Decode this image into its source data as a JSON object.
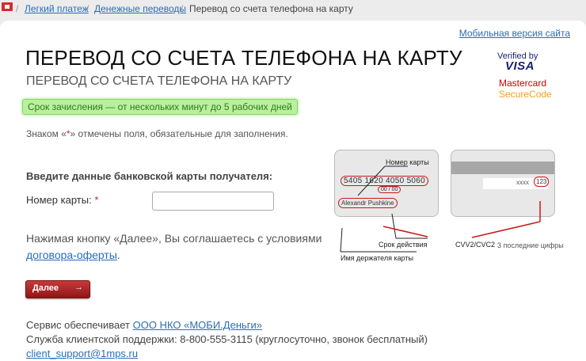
{
  "breadcrumbs": {
    "items": [
      "Легкий платеж",
      "Денежные переводы"
    ],
    "current": "Перевод со счета телефона на карту"
  },
  "header": {
    "mobile_link": "Мобильная версия сайта",
    "title": "ПЕРЕВОД СО СЧЕТА ТЕЛЕФОНА НА КАРТУ",
    "subtitle": "ПЕРЕВОД СО СЧЕТА ТЕЛЕФОНА НА КАРТУ"
  },
  "logos": {
    "visa_by": "Verified by",
    "visa": "VISA",
    "mastercard": "Mastercard",
    "securecode": "SecureCode"
  },
  "notice": "Срок зачисления — от нескольких минут до 5 рабочих дней",
  "required_note": {
    "before": "Знаком «",
    "star": "*",
    "after": "» отмечены поля, обязательные для заполнения."
  },
  "form": {
    "section_title": "Введите данные банковской карты получателя:",
    "card_number_label": "Номер карты:",
    "required_star": "*",
    "card_number_value": "",
    "agreement_text": "Нажимая кнопку «Далее», Вы соглашаетесь с условиями",
    "agreement_link": "договора-оферты",
    "agreement_end": ".",
    "next_button": "Далее",
    "next_arrow": "→"
  },
  "card_illustration": {
    "front": {
      "number": "5405 1620 4050 5060",
      "expiry": "00 / 00",
      "holder": "Alexandr Pushkine"
    },
    "back": {
      "cvv_mask": "xxxx",
      "cvv": "123"
    },
    "labels": {
      "card_number": "Номер карты",
      "expiry": "Срок действия",
      "holder": "Имя держателя карты",
      "cvv": "CVV2/CVC2",
      "cvv_hint": "3 последние цифры"
    }
  },
  "footer": {
    "service_text": "Сервис обеспечивает",
    "service_link": "ООО НКО «МОБИ.Деньги»",
    "support_text": "Служба клиентской поддержки: 8-800-555-3115 (круглосуточно, звонок бесплатный)",
    "email": "client_support@1mps.ru"
  },
  "colors": {
    "link": "#2a6db5",
    "notice_bg": "#b9ef9d",
    "button_red": "#b02727",
    "required_star": "#d31d1d"
  }
}
